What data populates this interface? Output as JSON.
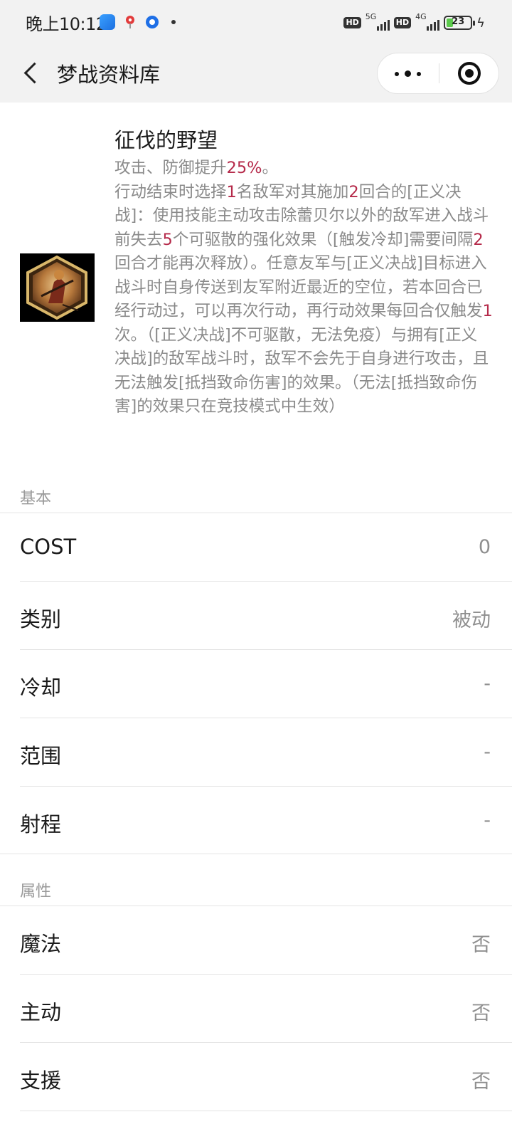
{
  "status_bar": {
    "time": "晚上10:12",
    "net1": "5G",
    "net2": "4G",
    "battery": "23",
    "hd": "HD"
  },
  "nav": {
    "title": "梦战资料库"
  },
  "skill": {
    "name": "征伐的野望",
    "description_parts": [
      {
        "t": "攻击、防御提升",
        "h": false
      },
      {
        "t": "25%",
        "h": true
      },
      {
        "t": "。\n行动结束时选择",
        "h": false
      },
      {
        "t": "1",
        "h": true
      },
      {
        "t": "名敌军对其施加",
        "h": false
      },
      {
        "t": "2",
        "h": true
      },
      {
        "t": "回合的[正义决战]：使用技能主动攻击除蕾贝尔以外的敌军进入战斗前失去",
        "h": false
      },
      {
        "t": "5",
        "h": true
      },
      {
        "t": "个可驱散的强化效果（[触发冷却]需要间隔",
        "h": false
      },
      {
        "t": "2",
        "h": true
      },
      {
        "t": "回合才能再次释放）。任意友军与[正义决战]目标进入战斗时自身传送到友军附近最近的空位，若本回合已经行动过，可以再次行动，再行动效果每回合仅触发",
        "h": false
      },
      {
        "t": "1",
        "h": true
      },
      {
        "t": "次。（[正义决战]不可驱散，无法免疫）与拥有[正义决战]的敌军战斗时，敌军不会先于自身进行攻击，且无法触发[抵挡致命伤害]的效果。（无法[抵挡致命伤害]的效果只在竞技模式中生效）",
        "h": false
      }
    ]
  },
  "basic": {
    "label": "基本",
    "rows": [
      {
        "key": "COST",
        "value": "0"
      },
      {
        "key": "类别",
        "value": "被动"
      },
      {
        "key": "冷却",
        "value": "-"
      },
      {
        "key": "范围",
        "value": "-"
      },
      {
        "key": "射程",
        "value": "-"
      }
    ]
  },
  "attributes": {
    "label": "属性",
    "rows": [
      {
        "key": "魔法",
        "value": "否"
      },
      {
        "key": "主动",
        "value": "否"
      },
      {
        "key": "支援",
        "value": "否"
      }
    ]
  }
}
